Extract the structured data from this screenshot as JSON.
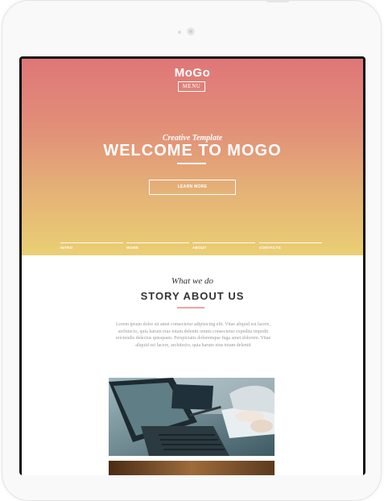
{
  "site": {
    "logo": "MoGo",
    "menu_label": "MENU",
    "hero": {
      "subtitle": "Creative Template",
      "headline": "WELCOME TO MOGO",
      "cta_label": "LEARN MORE"
    },
    "nav": [
      "INTRO",
      "WORK",
      "ABOUT",
      "CONTACTS"
    ],
    "story": {
      "subtitle": "What we do",
      "title": "STORY ABOUT US",
      "body": "Lorem ipsum dolor sit amet consectetur adipisicing elit. Vitae aliquid est facere, architecto, quia harum eius totam deleniti omnis consectetur expedita impedit reiciendis delectus quisquam. Perspiciatis doloremque fuga amet dolorem. Vitae aliquid est facere, architecto, quia harum eius totam deleniti"
    }
  },
  "colors": {
    "hero_gradient_top": "#df7678",
    "hero_gradient_bottom": "#eacf74",
    "accent_underline": "#f0a3a3"
  }
}
